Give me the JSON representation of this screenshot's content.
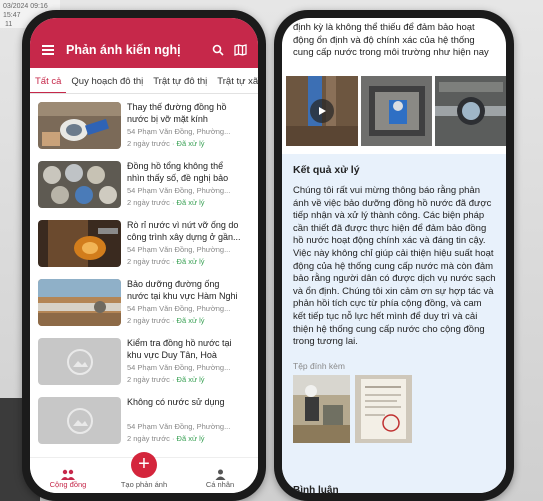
{
  "background": {
    "timestamp_text": "03/2024 09:16\n15:47\n 11"
  },
  "left_phone": {
    "app_title": "Phản ánh kiến nghị",
    "tabs": [
      {
        "label": "Tất cả",
        "active": true
      },
      {
        "label": "Quy hoạch đô thị",
        "active": false
      },
      {
        "label": "Trật tự đô thị",
        "active": false
      },
      {
        "label": "Trật tự xã",
        "active": false
      }
    ],
    "items": [
      {
        "title": "Thay thế đường đồng hồ nước bị vỡ mặt kính",
        "address": "54 Phạm Văn Đồng, Phường...",
        "time": "2 ngày trước",
        "status": "Đã xử lý",
        "thumb": "meter-repair"
      },
      {
        "title": "Đồng hồ tổng không thể nhìn thấy số, đề nghị bảo dưỡng",
        "address": "54 Phạm Văn Đồng, Phường...",
        "time": "2 ngày trước",
        "status": "Đã xử lý",
        "thumb": "meters"
      },
      {
        "title": "Rò rỉ nước vì nứt vỡ ống do công trình xây dựng ở gần...",
        "address": "54 Phạm Văn Đồng, Phường...",
        "time": "2 ngày trước",
        "status": "Đã xử lý",
        "thumb": "leak"
      },
      {
        "title": "Bảo dưỡng đường ống nước tại khu vực Hàm Nghi",
        "address": "54 Phạm Văn Đồng, Phường...",
        "time": "2 ngày trước",
        "status": "Đã xử lý",
        "thumb": "pipe"
      },
      {
        "title": "Kiểm tra đồng hồ nước tại khu vực Duy Tân, Hoà Thuậ...",
        "address": "54 Phạm Văn Đồng, Phường...",
        "time": "2 ngày trước",
        "status": "Đã xử lý",
        "thumb": "placeholder"
      },
      {
        "title": "Không có nước sử dụng",
        "address": "54 Phạm Văn Đồng, Phường...",
        "time": "2 ngày trước",
        "status": "Đã xử lý",
        "thumb": "placeholder"
      }
    ],
    "bottom_nav": [
      {
        "label": "Cộng đồng",
        "icon": "community-icon",
        "active": true
      },
      {
        "label": "Tạo phản ánh",
        "icon": "plus-icon",
        "active": false
      },
      {
        "label": "Cá nhân",
        "icon": "person-icon",
        "active": false
      }
    ],
    "fab_symbol": "+"
  },
  "right_phone": {
    "top_text": "định kỳ là không thể thiếu để đảm bảo hoạt động ổn định và độ chính xác của hệ thống cung cấp nước trong môi trường như hiện nay",
    "result_title": "Kết quả xử lý",
    "result_body": "Chúng tôi rất vui mừng thông báo rằng phản ánh về việc bảo dưỡng đồng hồ nước đã được tiếp nhận và xử lý thành công. Các biện pháp cần thiết đã được thực hiện để đảm bảo đồng hồ nước hoạt động chính xác và đáng tin cậy. Việc này không chỉ giúp cải thiện hiệu suất hoạt động của hệ thống cung cấp nước mà còn đảm bảo rằng người dân có được dịch vụ nước sạch và ổn định. Chúng tôi xin cảm ơn sự hợp tác và phản hồi tích cực từ phía cộng đồng, và cam kết tiếp tục nỗ lực hết mình để duy trì và cải thiện hệ thống cung cấp nước cho cộng đồng trong tương lai.",
    "attachments_label": "Tệp đính kèm",
    "comments_label": "Bình luận"
  },
  "colors": {
    "brand": "#c6284a",
    "status_ok": "#3aa155",
    "result_bg": "#e8f1fb"
  }
}
